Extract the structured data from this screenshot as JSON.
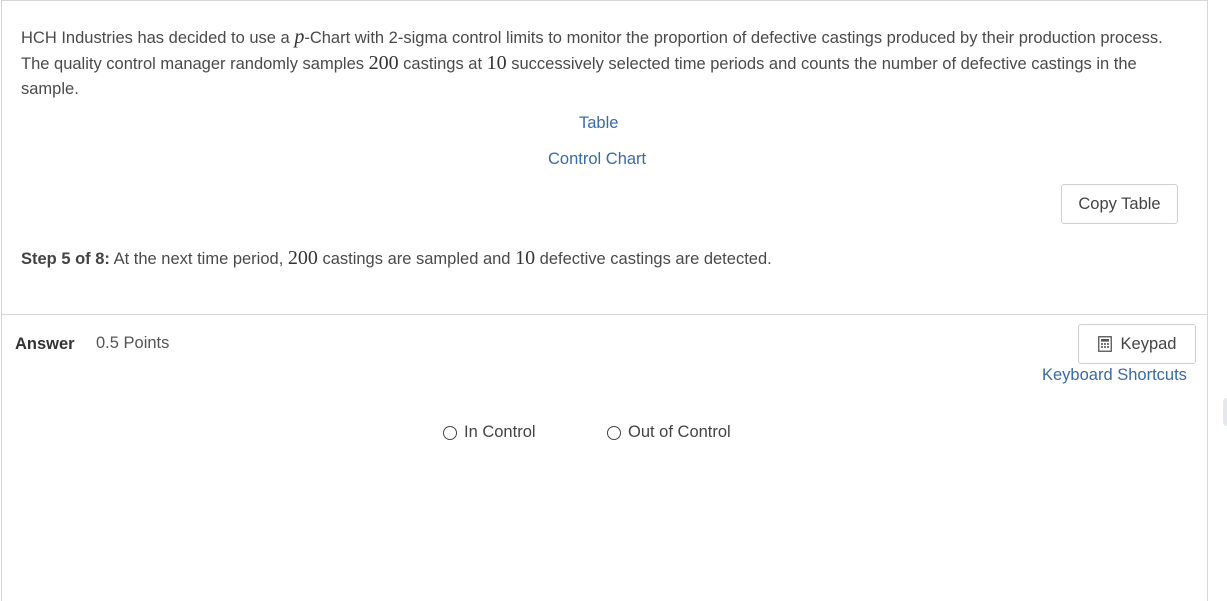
{
  "question": {
    "stem_part1": "HCH Industries has decided to use a ",
    "stem_p": "p",
    "stem_part2": "-Chart with 2-sigma control limits to monitor the proportion of defective castings produced by their production process. The quality control manager randomly samples ",
    "stem_sample_size": "200",
    "stem_part3": " castings at ",
    "stem_periods": "10",
    "stem_part4": " successively selected time periods and counts the number of defective castings in the sample.",
    "links": {
      "table": "Table",
      "control_chart": "Control Chart"
    },
    "copy_table_label": "Copy Table",
    "step_label": "Step 5 of 8:",
    "step_part1": " At the next time period, ",
    "step_sample_size": "200",
    "step_part2": " castings are sampled and ",
    "step_defects": "10",
    "step_part3": " defective castings are detected."
  },
  "answer": {
    "label": "Answer",
    "points": "0.5 Points",
    "keypad_label": "Keypad",
    "keypad_icon": "calculator-icon",
    "shortcuts_label": "Keyboard Shortcuts",
    "options": [
      {
        "label": "In Control",
        "selected": false
      },
      {
        "label": "Out of Control",
        "selected": false
      }
    ]
  },
  "colors": {
    "link": "#3a6aa5",
    "text": "#444444",
    "border": "#d6d6d6"
  }
}
